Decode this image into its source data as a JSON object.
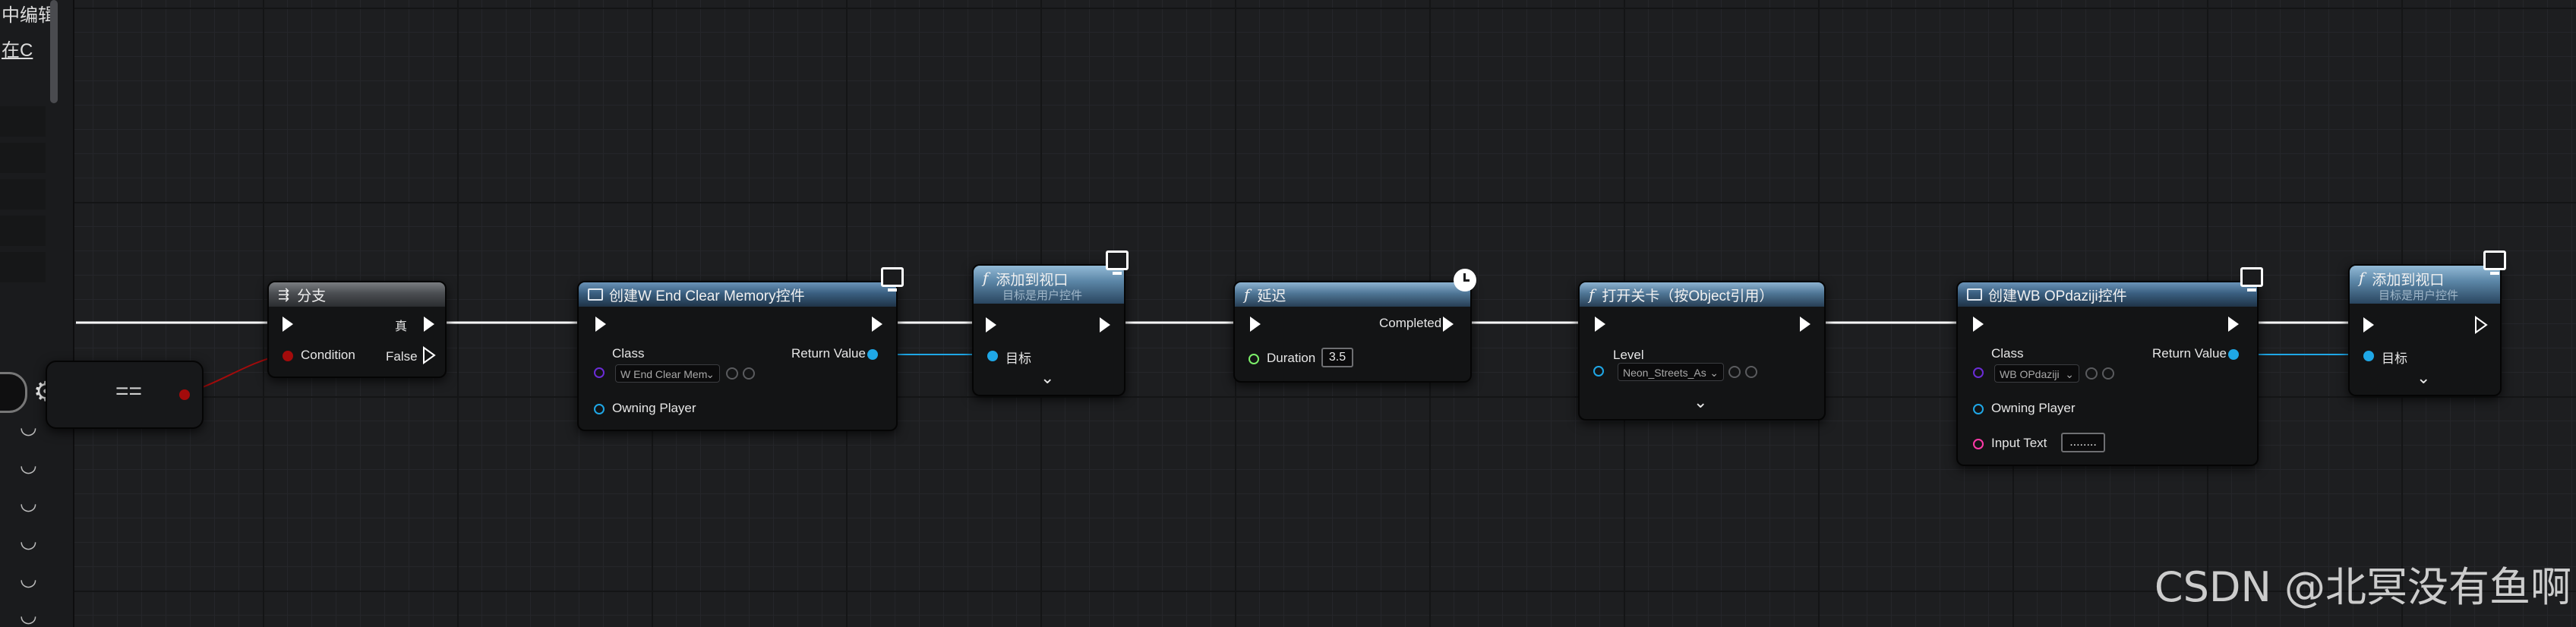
{
  "left_panel": {
    "line1": "中编辑",
    "line2": "在C"
  },
  "compare_node": {
    "op": "=="
  },
  "nodes": {
    "branch": {
      "title": "分支",
      "condition": "Condition",
      "true_label": "真",
      "false_label": "False"
    },
    "create_widget_1": {
      "title": "创建W End Clear Memory控件",
      "class_label": "Class",
      "class_value": "W End Clear Mem",
      "return_label": "Return Value",
      "owning_player": "Owning Player"
    },
    "add_viewport_1": {
      "title": "添加到视口",
      "subtitle": "目标是用户控件",
      "target_label": "目标"
    },
    "delay": {
      "title": "延迟",
      "completed": "Completed",
      "duration_label": "Duration",
      "duration_value": "3.5"
    },
    "open_level": {
      "title": "打开关卡（按Object引用）",
      "level_label": "Level",
      "level_value": "Neon_Streets_As"
    },
    "create_widget_2": {
      "title": "创建WB OPdaziji控件",
      "class_label": "Class",
      "class_value": "WB OPdaziji",
      "return_label": "Return Value",
      "owning_player": "Owning Player",
      "input_text_label": "Input Text",
      "input_text_value": "........"
    },
    "add_viewport_2": {
      "title": "添加到视口",
      "subtitle": "目标是用户控件",
      "target_label": "目标"
    }
  },
  "icons": {
    "branch": "branch-icon",
    "widget": "monitor-icon",
    "delay": "clock-icon",
    "function": "function-icon",
    "settings": "gear-icon"
  },
  "colors": {
    "exec": "#ffffff",
    "object_pin": "#1fa7e6",
    "bool_pin": "#a30b0b",
    "float_pin": "#7cf06a",
    "string_pin": "#ff3aa8",
    "class_pin": "#6b2cd6"
  },
  "watermark": "CSDN @北冥没有鱼啊"
}
